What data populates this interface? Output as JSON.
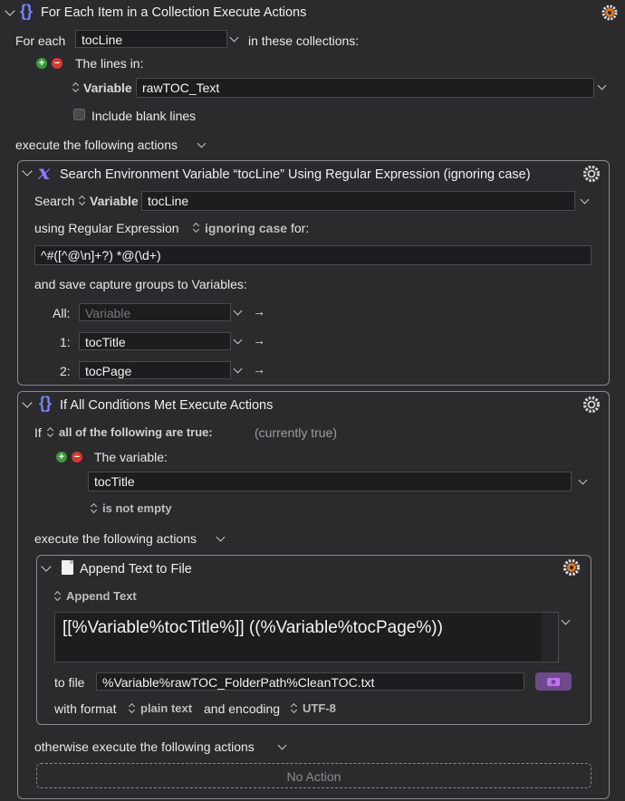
{
  "outer": {
    "title": "For Each Item in a Collection Execute Actions",
    "for_each_label": "For each",
    "variable": "tocLine",
    "in_collections_label": "in these collections:",
    "lines_in_label": "The lines in:",
    "source_type": "Variable",
    "source_value": "rawTOC_Text",
    "include_blank_label": "Include blank lines",
    "execute_label": "execute the following actions"
  },
  "search": {
    "title": "Search Environment Variable “tocLine” Using Regular Expression (ignoring case)",
    "search_label": "Search",
    "source_type": "Variable",
    "source_value": "tocLine",
    "using_label": "using Regular Expression",
    "case_option": "ignoring case",
    "for_label": "for:",
    "regex": "^#([^@\\n]+?) *@(\\d+)",
    "capture_label": "and save capture groups to Variables:",
    "captures": [
      {
        "label": "All:",
        "value": "",
        "placeholder": "Variable"
      },
      {
        "label": "1:",
        "value": "tocTitle",
        "placeholder": ""
      },
      {
        "label": "2:",
        "value": "tocPage",
        "placeholder": ""
      }
    ]
  },
  "ifblock": {
    "title": "If All Conditions Met Execute Actions",
    "if_label": "If",
    "condition_mode": "all of the following are true:",
    "status": "(currently true)",
    "variable_label": "The variable:",
    "variable_value": "tocTitle",
    "test": "is not empty",
    "execute_label": "execute the following actions",
    "otherwise_label": "otherwise execute the following actions",
    "no_action": "No Action"
  },
  "append": {
    "title": "Append Text to File",
    "mode": "Append Text",
    "text": "[[%Variable%tocTitle%]] ((%Variable%tocPage%))",
    "to_file_label": "to file",
    "file_path": "%Variable%rawTOC_FolderPath%CleanTOC.txt",
    "with_format_label": "with format",
    "format": "plain text",
    "encoding_label": "and encoding",
    "encoding": "UTF-8"
  },
  "colors": {
    "background": "#2b2b2d",
    "field": "#1d1d1f",
    "accent_purple": "#7a83ff",
    "plus_green": "#3a9a3e",
    "minus_red": "#d43a32",
    "gear_orange": "#e0781e"
  }
}
